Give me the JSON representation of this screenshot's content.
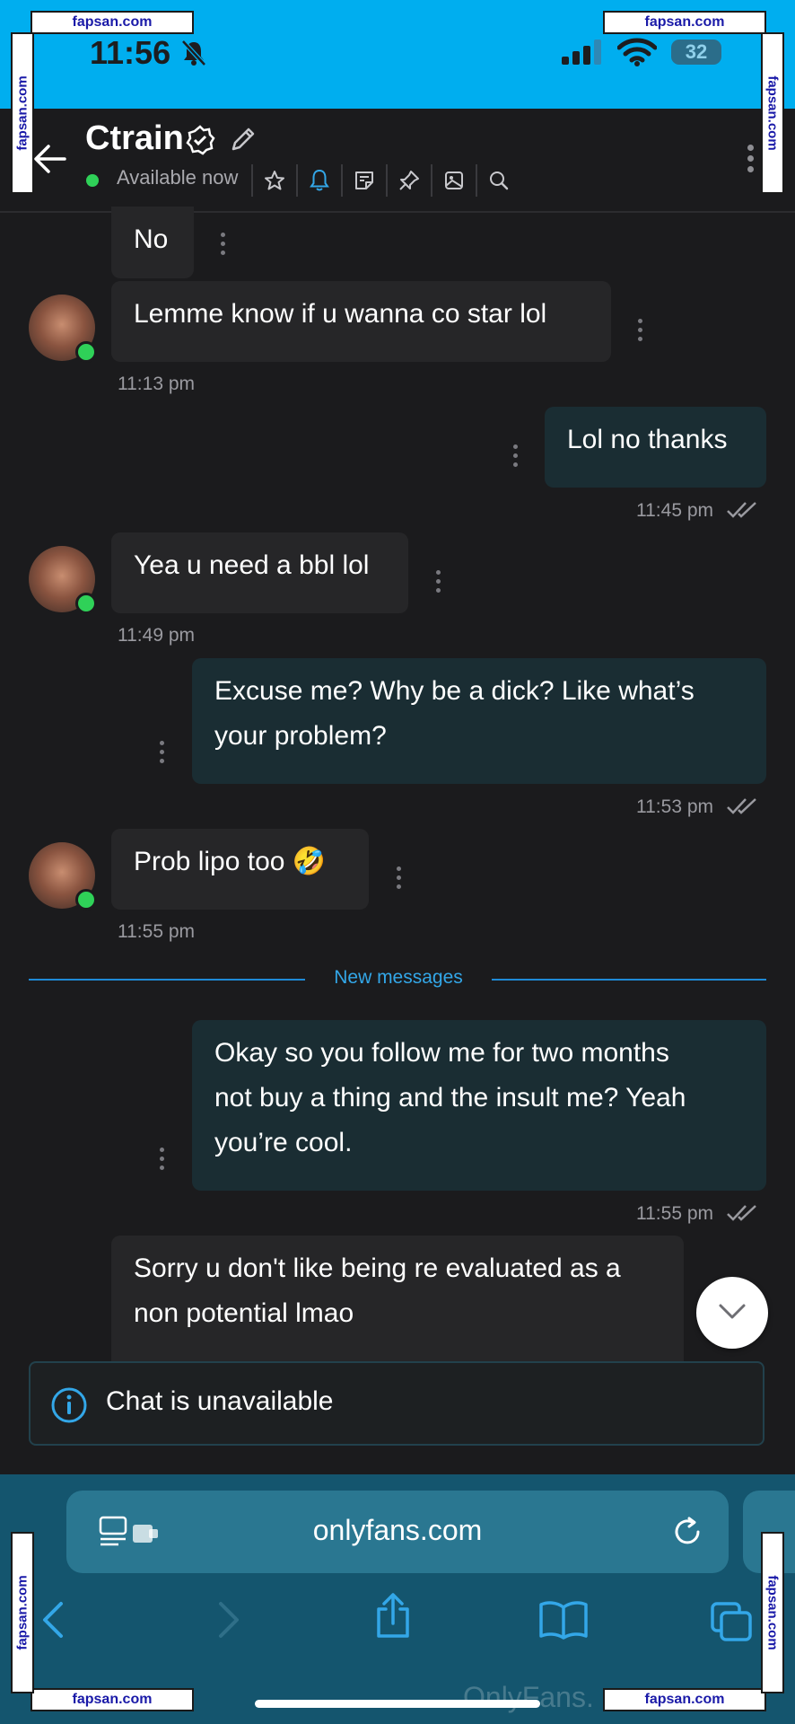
{
  "status_bar": {
    "time": "11:56",
    "battery": "32",
    "icons": [
      "bell-slash-icon",
      "signal-icon",
      "wifi-icon",
      "battery-icon"
    ]
  },
  "header": {
    "title": "Ctrain",
    "presence": "Available now",
    "icons": [
      "back-arrow-icon",
      "verified-icon",
      "pencil-icon",
      "star-icon",
      "bell-icon",
      "note-icon",
      "pin-icon",
      "image-icon",
      "search-icon",
      "more-vertical-icon"
    ]
  },
  "messages": [
    {
      "side": "in",
      "text": "No"
    },
    {
      "side": "in",
      "text": "Lemme know if u wanna co star lol",
      "time": "11:13 pm"
    },
    {
      "side": "out",
      "text": "Lol no thanks",
      "time": "11:45 pm"
    },
    {
      "side": "in",
      "text": "Yea u need a bbl lol",
      "time": "11:49 pm"
    },
    {
      "side": "out",
      "lines": [
        "Excuse me? Why be a dick? Like what’s",
        "your problem?"
      ],
      "time": "11:53 pm"
    },
    {
      "side": "in",
      "text": "Prob lipo too 🤣",
      "time": "11:55 pm"
    },
    {
      "side": "out",
      "lines": [
        "Okay so you follow me for two months",
        "not buy a thing and the insult me? Yeah",
        "you’re cool."
      ],
      "time": "11:55 pm"
    },
    {
      "side": "in",
      "lines": [
        "Sorry u don't like being re evaluated as a",
        "non potential lmao"
      ]
    }
  ],
  "divider": {
    "label": "New messages"
  },
  "composer": {
    "unavailable_text": "Chat is unavailable"
  },
  "browser": {
    "url": "onlyfans.com",
    "watermark": "OnlyFans.",
    "toolbar_icons": [
      "back-icon",
      "forward-icon",
      "share-icon",
      "bookmarks-icon",
      "tabs-icon"
    ]
  },
  "watermarks": {
    "label": "fapsan.com"
  },
  "colors": {
    "status_bar": "#00aeef",
    "background": "#1b1b1d",
    "incoming_bubble": "#262628",
    "outgoing_bubble": "#1a2d33",
    "accent": "#33a7e8",
    "browser_bar": "#14556e"
  }
}
